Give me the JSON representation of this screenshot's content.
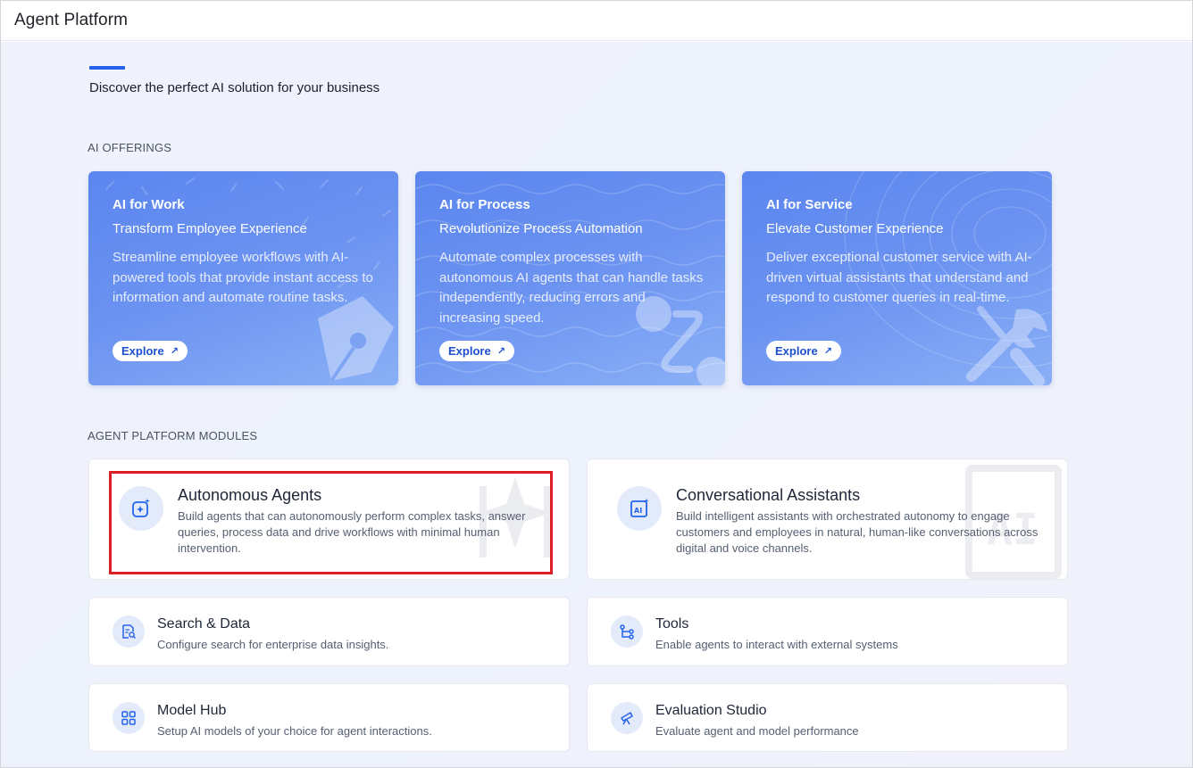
{
  "header": {
    "title": "Agent Platform"
  },
  "intro": {
    "tagline": "Discover the perfect AI solution for your business"
  },
  "sections": {
    "offerings_label": "AI OFFERINGS",
    "modules_label": "AGENT PLATFORM MODULES"
  },
  "offerings": [
    {
      "title": "AI for Work",
      "subtitle": "Transform Employee Experience",
      "description": "Streamline employee workflows with AI-powered tools that provide instant access to information and automate routine tasks.",
      "button": "Explore",
      "icon": "pen-nib-icon"
    },
    {
      "title": "AI for Process",
      "subtitle": "Revolutionize Process Automation",
      "description": "Automate complex processes with autonomous AI agents that can handle tasks independently, reducing errors and increasing speed.",
      "button": "Explore",
      "icon": "workflow-icon"
    },
    {
      "title": "AI for Service",
      "subtitle": "Elevate Customer Experience",
      "description": "Deliver exceptional customer service with AI-driven virtual assistants that understand and respond to customer queries in real-time.",
      "button": "Explore",
      "icon": "tools-icon"
    }
  ],
  "modules": [
    {
      "title": "Autonomous Agents",
      "description": "Build agents that can autonomously perform complex tasks, answer queries, process data and drive workflows with minimal human intervention.",
      "icon": "sparkle-agent-icon"
    },
    {
      "title": "Conversational Assistants",
      "description": "Build intelligent assistants with orchestrated autonomy to engage customers and employees in natural, human-like conversations across digital and voice channels.",
      "icon": "ai-chip-icon"
    },
    {
      "title": "Search & Data",
      "description": "Configure search for enterprise data insights.",
      "icon": "document-search-icon"
    },
    {
      "title": "Tools",
      "description": "Enable agents to interact with external systems",
      "icon": "tools-flow-icon"
    },
    {
      "title": "Model Hub",
      "description": "Setup AI models of your choice for agent interactions.",
      "icon": "grid-icon"
    },
    {
      "title": "Evaluation Studio",
      "description": "Evaluate agent and model performance",
      "icon": "telescope-icon"
    }
  ],
  "colors": {
    "accent": "#2563eb",
    "card_gradient_start": "#5b86ef",
    "highlight": "#dc1f26",
    "icon_bg": "#e3ebfb"
  }
}
